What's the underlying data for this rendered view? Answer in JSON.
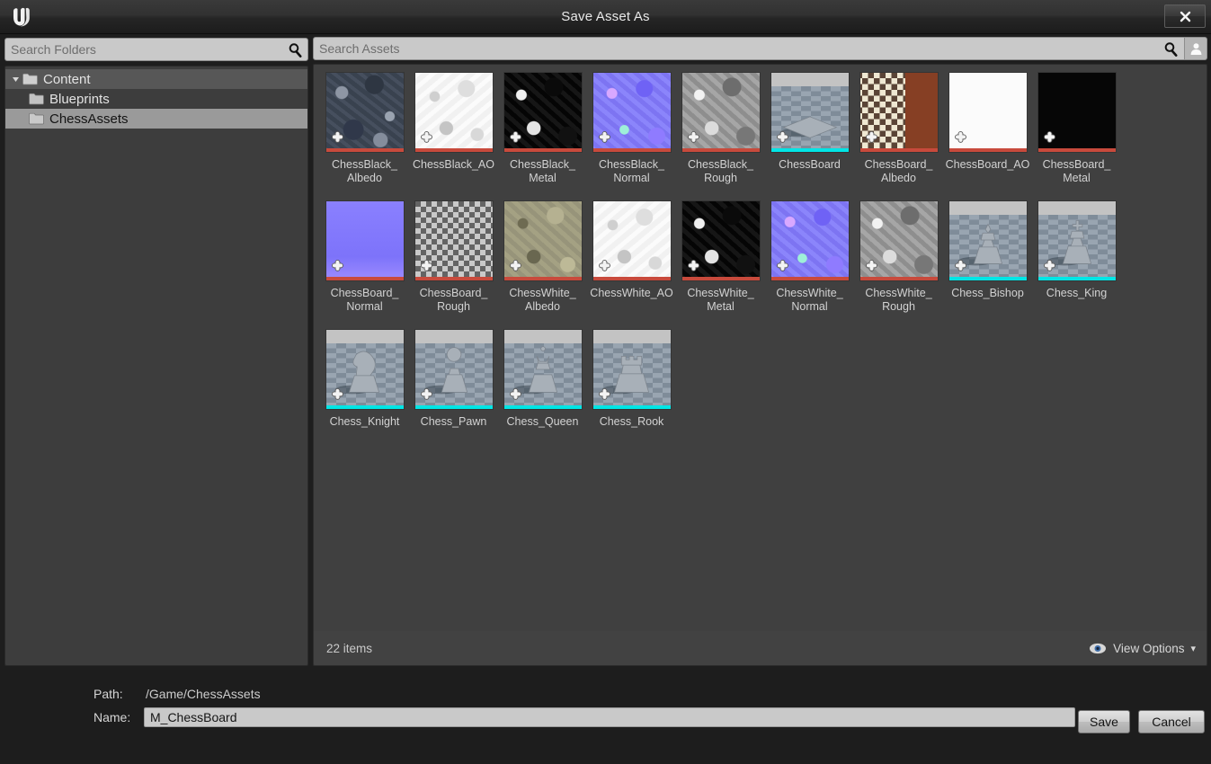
{
  "window": {
    "title": "Save Asset As",
    "logo_icon": "unreal-engine-logo",
    "close_label": "✕",
    "close_icon": "close-icon"
  },
  "folder_search": {
    "placeholder": "Search Folders",
    "value": "",
    "icon": "search-icon"
  },
  "asset_search": {
    "placeholder": "Search Assets",
    "value": "",
    "icon": "search-icon",
    "user_icon": "user-icon"
  },
  "folder_tree": [
    {
      "label": "Content",
      "depth": 0,
      "expanded": true,
      "selected": false,
      "hovered": true,
      "icon": "folder-open-icon"
    },
    {
      "label": "Blueprints",
      "depth": 1,
      "expanded": false,
      "selected": false,
      "hovered": false,
      "icon": "folder-icon"
    },
    {
      "label": "ChessAssets",
      "depth": 1,
      "expanded": false,
      "selected": true,
      "hovered": false,
      "icon": "folder-icon"
    }
  ],
  "assets": [
    {
      "name": "ChessBlack_\nAlbedo",
      "type": "texture",
      "thumb": "tx-swirl-dark",
      "dirty": true
    },
    {
      "name": "ChessBlack_AO",
      "type": "texture",
      "thumb": "tx-swirl-white",
      "dirty": true
    },
    {
      "name": "ChessBlack_\nMetal",
      "type": "texture",
      "thumb": "tx-swirl-black",
      "dirty": true
    },
    {
      "name": "ChessBlack_\nNormal",
      "type": "texture",
      "thumb": "tx-swirl-normal",
      "dirty": true
    },
    {
      "name": "ChessBlack_\nRough",
      "type": "texture",
      "thumb": "tx-swirl-gray",
      "dirty": true
    },
    {
      "name": "ChessBoard",
      "type": "staticmesh",
      "thumb": "mesh-board",
      "dirty": true
    },
    {
      "name": "ChessBoard_\nAlbedo",
      "type": "texture",
      "thumb": "tx-board-albedo",
      "dirty": true
    },
    {
      "name": "ChessBoard_AO",
      "type": "texture",
      "thumb": "tx-white-flat",
      "dirty": true
    },
    {
      "name": "ChessBoard_\nMetal",
      "type": "texture",
      "thumb": "tx-black-flat",
      "dirty": true
    },
    {
      "name": "ChessBoard_\nNormal",
      "type": "texture",
      "thumb": "tx-board-normal",
      "dirty": true
    },
    {
      "name": "ChessBoard_\nRough",
      "type": "texture",
      "thumb": "tx-board-rough",
      "dirty": true
    },
    {
      "name": "ChessWhite_\nAlbedo",
      "type": "texture",
      "thumb": "tx-swirl-tan",
      "dirty": true
    },
    {
      "name": "ChessWhite_AO",
      "type": "texture",
      "thumb": "tx-swirl-white",
      "dirty": true
    },
    {
      "name": "ChessWhite_\nMetal",
      "type": "texture",
      "thumb": "tx-swirl-black",
      "dirty": true
    },
    {
      "name": "ChessWhite_\nNormal",
      "type": "texture",
      "thumb": "tx-swirl-normal",
      "dirty": true
    },
    {
      "name": "ChessWhite_\nRough",
      "type": "texture",
      "thumb": "tx-swirl-gray",
      "dirty": true
    },
    {
      "name": "Chess_Bishop",
      "type": "staticmesh",
      "thumb": "mesh-bishop",
      "dirty": true
    },
    {
      "name": "Chess_King",
      "type": "staticmesh",
      "thumb": "mesh-king",
      "dirty": true
    },
    {
      "name": "Chess_Knight",
      "type": "staticmesh",
      "thumb": "mesh-knight",
      "dirty": true
    },
    {
      "name": "Chess_Pawn",
      "type": "staticmesh",
      "thumb": "mesh-pawn",
      "dirty": true
    },
    {
      "name": "Chess_Queen",
      "type": "staticmesh",
      "thumb": "mesh-queen",
      "dirty": true
    },
    {
      "name": "Chess_Rook",
      "type": "staticmesh",
      "thumb": "mesh-rook",
      "dirty": true
    }
  ],
  "asset_footer": {
    "item_count_label": "22 items",
    "view_options_label": "View Options",
    "view_options_icon": "eye-icon",
    "view_options_caret": "▾"
  },
  "form": {
    "path_label": "Path:",
    "path_value": "/Game/ChessAssets",
    "name_label": "Name:",
    "name_value": "M_ChessBoard",
    "name_placeholder": ""
  },
  "buttons": {
    "save_label": "Save",
    "cancel_label": "Cancel"
  },
  "colors": {
    "texture_type": "#c84a3c",
    "staticmesh_type": "#00e5e5",
    "selection": "#9a9a9a",
    "panel_bg": "#404040",
    "window_bg": "#1d1d1d"
  }
}
